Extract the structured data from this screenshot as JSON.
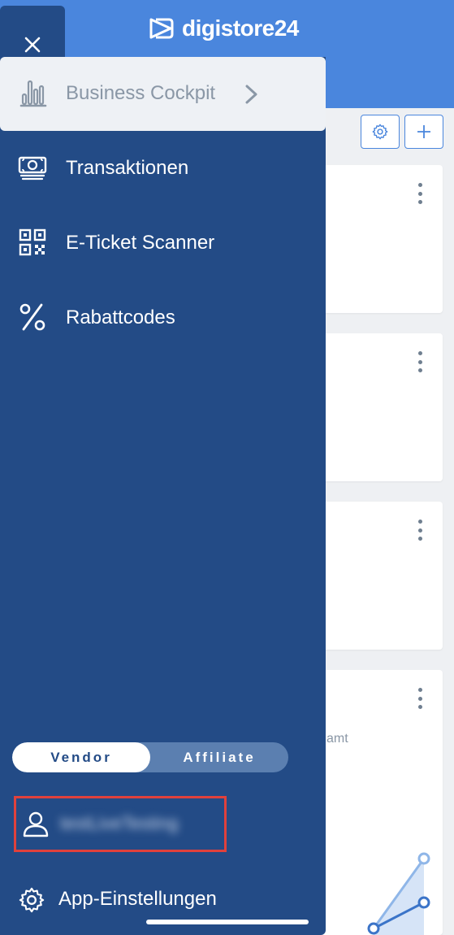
{
  "header": {
    "brand_name": "digistore24",
    "brand_color": "#4a86dd",
    "brand_icon": "digistore-logo-icon"
  },
  "toolbar": {
    "settings_icon": "gear-icon",
    "add_icon": "plus-icon"
  },
  "cards": {
    "partial_text": "amt"
  },
  "drawer": {
    "background_color": "#234b86",
    "close_icon": "close-icon",
    "items": [
      {
        "label": "Business Cockpit",
        "icon": "bar-chart-icon",
        "active": true
      },
      {
        "label": "Transaktionen",
        "icon": "money-icon"
      },
      {
        "label": "E-Ticket Scanner",
        "icon": "qr-code-icon"
      },
      {
        "label": "Rabattcodes",
        "icon": "percent-icon"
      }
    ],
    "role_toggle": {
      "vendor_label": "Vendor",
      "affiliate_label": "Affiliate",
      "selected": "Vendor"
    },
    "user": {
      "icon": "user-icon",
      "name": "testLiveTesting"
    },
    "settings": {
      "label": "App-Einstellungen",
      "icon": "gear-icon"
    }
  }
}
